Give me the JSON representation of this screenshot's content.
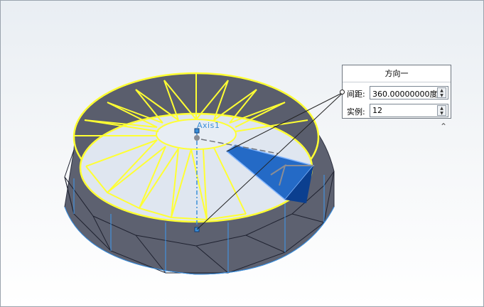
{
  "scene": {
    "axis_label": "Axis1"
  },
  "pattern_panel": {
    "title": "方向一",
    "spacing": {
      "label": "间距:",
      "value": "360.00000000度"
    },
    "instances": {
      "label": "实例:",
      "value": "12"
    },
    "collapse_icon": "chevron-up"
  }
}
